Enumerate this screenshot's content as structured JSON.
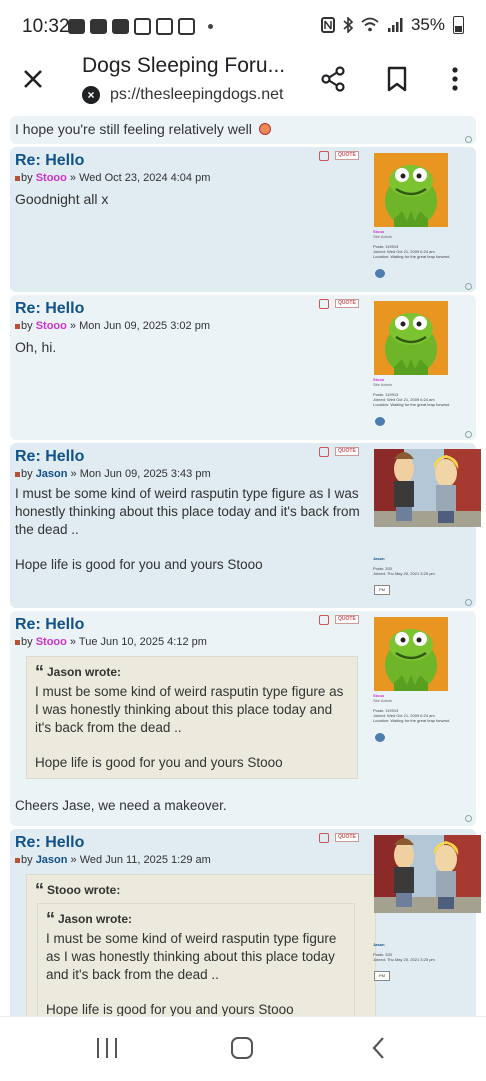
{
  "status_bar": {
    "time": "10:32",
    "battery": "35%"
  },
  "browser": {
    "title": "Dogs Sleeping Foru...",
    "url": "ps://thesleepingdogs.net",
    "url_icon": "x-circle-icon"
  },
  "top_snippet": {
    "text": "I hope you're still feeling relatively well"
  },
  "posts": [
    {
      "title": "Re: Hello",
      "by": "by",
      "author": "Stooo",
      "sep": "»",
      "date": "Wed Oct 23, 2024 4:04 pm",
      "body": [
        "Goodnight all x"
      ],
      "quote_label": "QUOTE",
      "profile": {
        "name": "Stooo",
        "rank": "Site Admin",
        "posts": "Posts: 119913",
        "joined": "Joined: Wed Oct 21, 2009 6:24 am",
        "location": "Location: Waiting for the great leap forward"
      }
    },
    {
      "title": "Re: Hello",
      "by": "by",
      "author": "Stooo",
      "sep": "»",
      "date": "Mon Jun 09, 2025 3:02 pm",
      "body": [
        "Oh, hi."
      ],
      "quote_label": "QUOTE",
      "profile": {
        "name": "Stooo",
        "rank": "Site Admin",
        "posts": "Posts: 119913",
        "joined": "Joined: Wed Oct 21, 2009 6:24 am",
        "location": "Location: Waiting for the great leap forward"
      }
    },
    {
      "title": "Re: Hello",
      "by": "by",
      "author": "Jason",
      "sep": "»",
      "date": "Mon Jun 09, 2025 3:43 pm",
      "body": [
        "I must be some kind of weird rasputin type figure as I was honestly thinking about this place today and it's back from the dead ..",
        "Hope life is good for you and yours Stooo"
      ],
      "quote_label": "QUOTE",
      "profile": {
        "name": "Jason",
        "posts": "Posts: 333",
        "joined": "Joined: Thu May 20, 2021 3:25 pm",
        "pm": "PM"
      }
    },
    {
      "title": "Re: Hello",
      "by": "by",
      "author": "Stooo",
      "sep": "»",
      "date": "Tue Jun 10, 2025 4:12 pm",
      "quote": {
        "cite": "Jason wrote:",
        "body": [
          "I must be some kind of weird rasputin type figure as I was honestly thinking about this place today and it's back from the dead ..",
          "Hope life is good for you and yours Stooo"
        ]
      },
      "body": [
        "Cheers Jase, we need a makeover."
      ],
      "quote_label": "QUOTE",
      "profile": {
        "name": "Stooo",
        "rank": "Site Admin",
        "posts": "Posts: 119913",
        "joined": "Joined: Wed Oct 21, 2009 6:24 am",
        "location": "Location: Waiting for the great leap forward"
      }
    },
    {
      "title": "Re: Hello",
      "by": "by",
      "author": "Jason",
      "sep": "»",
      "date": "Wed Jun 11, 2025 1:29 am",
      "quote": {
        "cite": "Stooo wrote:",
        "inner_cite": "Jason wrote:",
        "body": [
          "I must be some kind of weird rasputin type figure as I was honestly thinking about this place today and it's back from the dead ..",
          "Hope life is good for you and yours Stooo"
        ]
      },
      "quote_label": "QUOTE",
      "profile": {
        "name": "Jason",
        "posts": "Posts: 333",
        "joined": "Joined: Thu May 20, 2021 3:25 pm",
        "pm": "PM"
      }
    }
  ],
  "colors": {
    "post_bg_a": "#e1ebf2",
    "post_bg_b": "#ecf3f7",
    "title": "#105289",
    "admin_name": "#cc33cc",
    "quote_bg": "#ebeadd"
  }
}
